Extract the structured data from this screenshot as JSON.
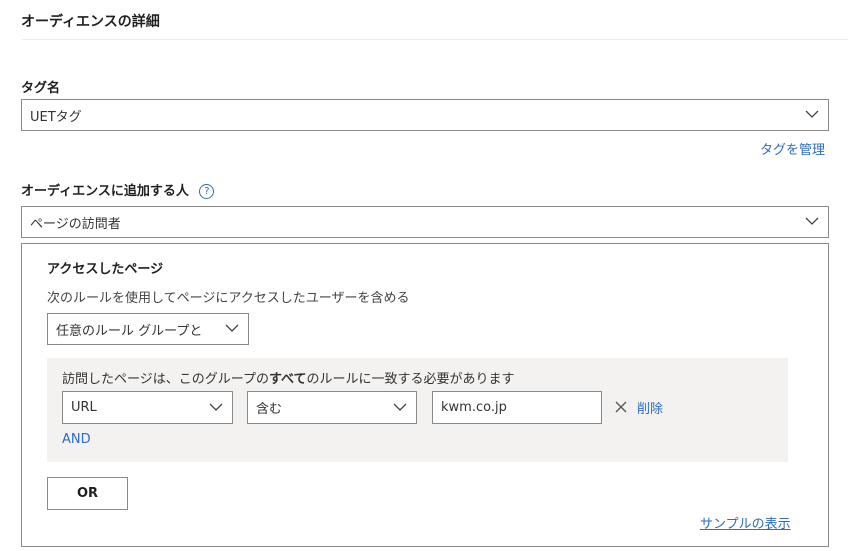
{
  "page_title": "オーディエンスの詳細",
  "tag": {
    "label": "タグ名",
    "value": "UETタグ",
    "manage_link": "タグを管理"
  },
  "audience": {
    "label": "オーディエンスに追加する人",
    "help_icon": "?",
    "value": "ページの訪問者"
  },
  "visited": {
    "title": "アクセスしたページ",
    "description": "次のルールを使用してページにアクセスしたユーザーを含める",
    "group_select": "任意のルール グループと",
    "rule_group": {
      "sentence_prefix": "訪問したページは、このグループの",
      "sentence_bold": "すべて",
      "sentence_suffix": "のルールに一致する必要があります",
      "field": "URL",
      "operator": "含む",
      "value": "kwm.co.jp",
      "delete_label": "削除",
      "and_label": "AND"
    },
    "or_button": "OR",
    "sample_link": "サンプルの表示"
  }
}
